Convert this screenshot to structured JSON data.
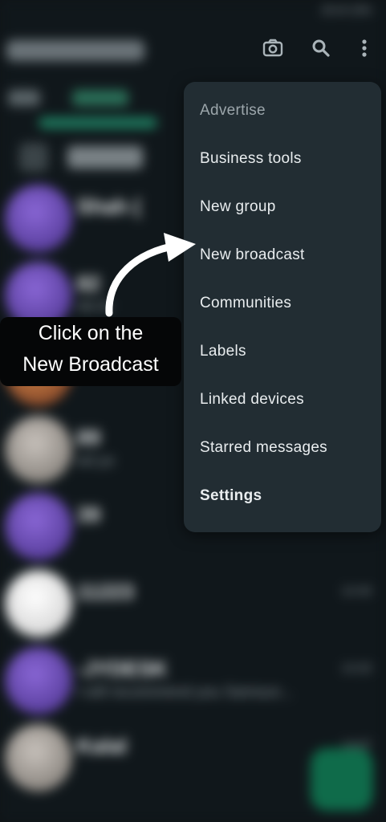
{
  "status_bar": {
    "text": "20.4l 13%"
  },
  "header": {
    "title_hidden": "",
    "camera_icon": "camera-icon",
    "search_icon": "search-icon",
    "more_icon": "more-vert-icon"
  },
  "menu": {
    "items": [
      {
        "label": "Advertise"
      },
      {
        "label": "Business tools"
      },
      {
        "label": "New group"
      },
      {
        "label": "New broadcast"
      },
      {
        "label": "Communities"
      },
      {
        "label": "Labels"
      },
      {
        "label": "Linked devices"
      },
      {
        "label": "Starred messages"
      },
      {
        "label": "Settings"
      }
    ]
  },
  "callout": {
    "line1": "Click on the",
    "line2": "New Broadcast"
  },
  "chats": [
    {
      "name": "Shah (",
      "preview": "",
      "time": ""
    },
    {
      "name": "82",
      "preview": "All Al",
      "time": ""
    },
    {
      "name": "5",
      "preview": "",
      "time": ""
    },
    {
      "name": "89",
      "preview": "ed yo",
      "time": ""
    },
    {
      "name": "39",
      "preview": "",
      "time": ""
    },
    {
      "name": "11223",
      "preview": "",
      "time": "14:40"
    },
    {
      "name": "-JYDESK",
      "preview": "I will recommend you Samsun...",
      "time": "14:20"
    },
    {
      "name": "Kalal",
      "preview": "",
      "time": "14:07"
    }
  ],
  "colors": {
    "menu_bg": "#222d33",
    "accent_green": "#1e7a5e",
    "callout_bg": "#050607"
  }
}
